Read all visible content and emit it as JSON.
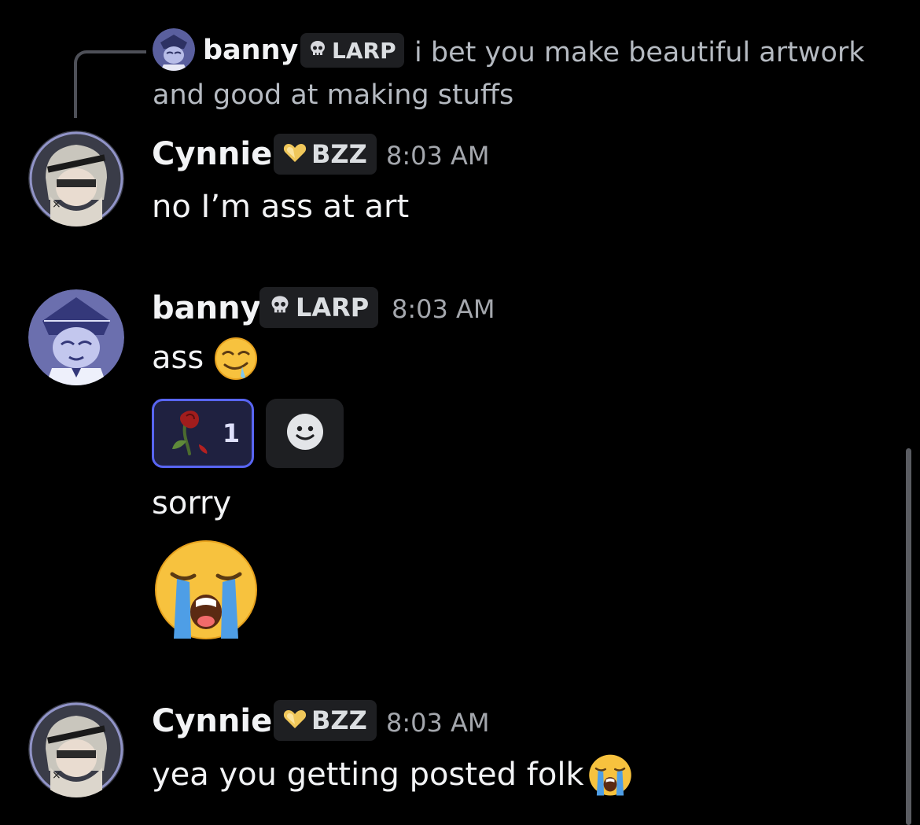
{
  "reply": {
    "username": "banny",
    "tag_label": "LARP",
    "text": "i bet you make beautiful artwork and good at making stuffs"
  },
  "messages": [
    {
      "username": "Cynnie",
      "tag_label": "BZZ",
      "time": "8:03 AM",
      "lines": [
        "no I’m ass at art"
      ]
    },
    {
      "username": "banny",
      "tag_label": "LARP",
      "time": "8:03 AM",
      "lines": [
        "ass",
        "sorry"
      ],
      "reaction": {
        "emoji": "wilted-rose",
        "count": "1"
      }
    },
    {
      "username": "Cynnie",
      "tag_label": "BZZ",
      "time": "8:03 AM",
      "lines": [
        "yea you getting posted folk"
      ]
    }
  ],
  "icons": {
    "larp_tag": "skull-icon",
    "bzz_tag": "heart-icon",
    "add_reaction": "smiley-icon",
    "emoji_drool": "drooling-face-emoji",
    "emoji_cry": "loudly-crying-face-emoji"
  },
  "colors": {
    "background": "#000000",
    "username": "#f2f3f5",
    "timestamp": "#a4a7ad",
    "reply_text": "#b5bac1",
    "tag_bg": "#1e1f22",
    "reaction_border": "#5865f2",
    "heart": "#f0c75a"
  }
}
